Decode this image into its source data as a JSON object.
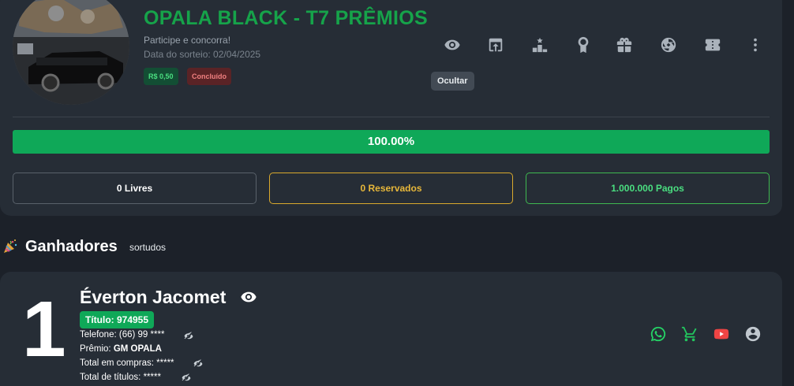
{
  "raffle": {
    "title": "OPALA BLACK - T7 PRÊMIOS",
    "subtitle": "Participe e concorra!",
    "draw_date": "Data do sorteio: 02/04/2025",
    "price_badge": "R$ 0,50",
    "status_badge": "Concluído",
    "progress_label": "100.00%",
    "progress_fraction": 1.0
  },
  "toolbar": {
    "icons": [
      "eye-icon",
      "share-icon",
      "podium-icon",
      "award-icon",
      "gift-icon",
      "wheel-icon",
      "ticket-icon",
      "more-vertical-icon"
    ],
    "tooltip": "Ocultar"
  },
  "stats": {
    "free": "0 Livres",
    "reserved": "0 Reservados",
    "paid": "1.000.000 Pagos"
  },
  "winners": {
    "title": "Ganhadores",
    "subtitle": "sortudos",
    "items": [
      {
        "rank": "1",
        "name": "Éverton Jacomet",
        "ticket": "Título: 974955",
        "phone_label": "Telefone:",
        "phone": "(66) 99 ****",
        "prize_label": "Prêmio:",
        "prize": "GM OPALA",
        "total_purchases_label": "Total em compras:",
        "total_purchases": "*****",
        "total_titles_label": "Total de títulos:",
        "total_titles": "*****"
      }
    ]
  },
  "colors": {
    "accent_green": "#16a34a",
    "whatsapp": "#25d366",
    "cart": "#22c55e",
    "youtube": "#ef4444",
    "reserved": "#e7b73a"
  }
}
